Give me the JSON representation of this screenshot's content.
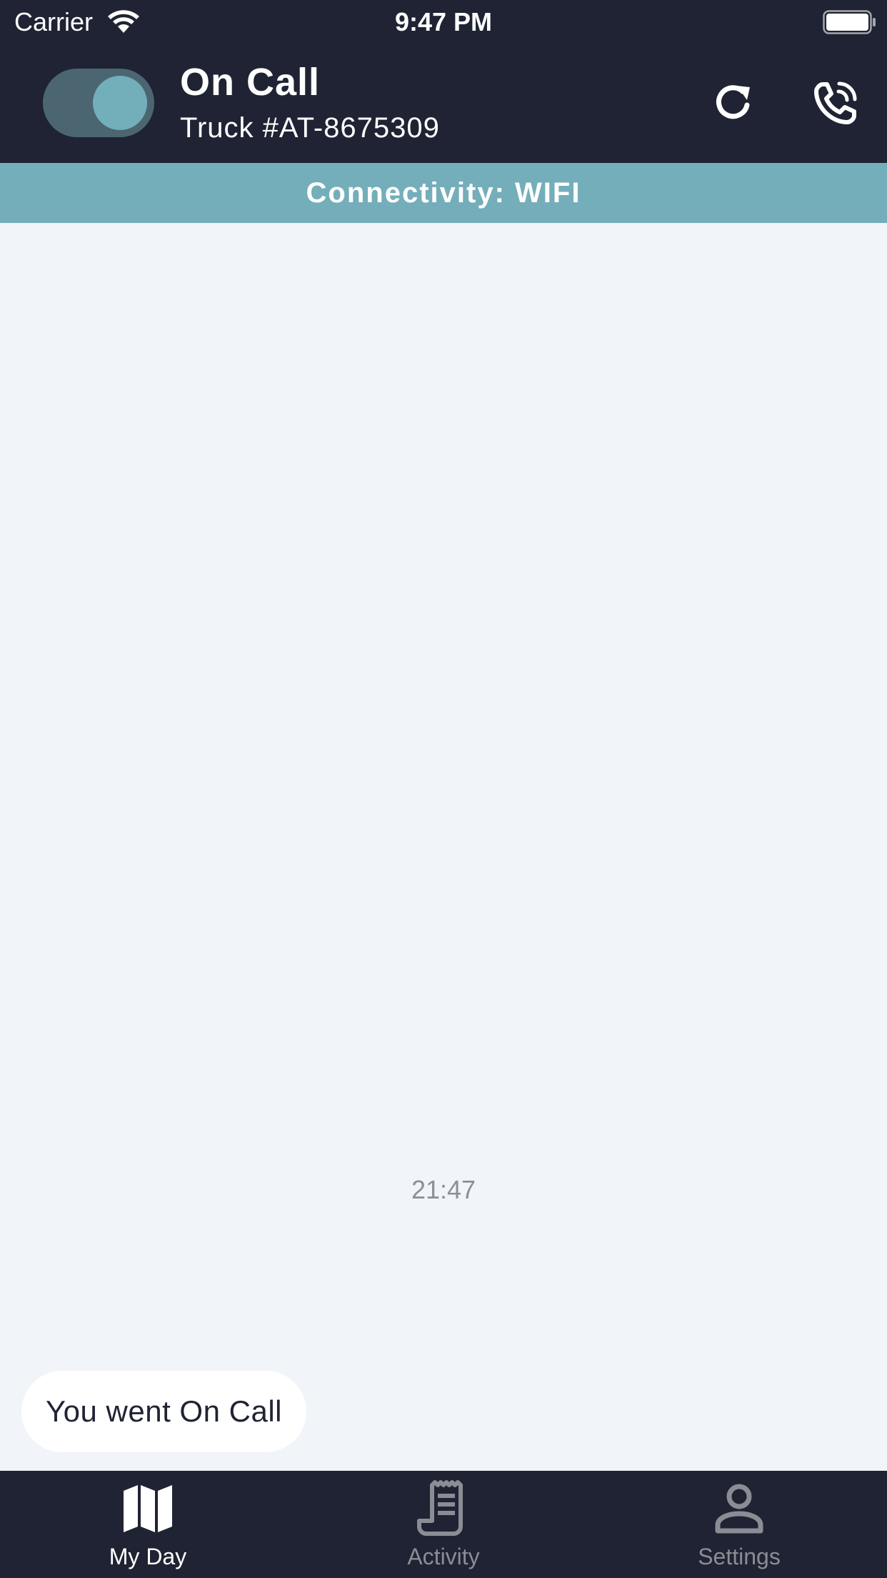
{
  "status_bar": {
    "carrier": "Carrier",
    "time": "9:47 PM"
  },
  "header": {
    "toggle_on": true,
    "title": "On Call",
    "subtitle": "Truck #AT-8675309",
    "actions": [
      "refresh-icon",
      "phone-icon"
    ]
  },
  "connectivity": {
    "label": "Connectivity: WIFI"
  },
  "feed": {
    "timestamp": "21:47",
    "messages": [
      {
        "text": "You went On Call"
      }
    ]
  },
  "tabbar": {
    "tabs": [
      {
        "label": "My Day",
        "icon": "map-icon",
        "active": true
      },
      {
        "label": "Activity",
        "icon": "receipt-icon",
        "active": false
      },
      {
        "label": "Settings",
        "icon": "person-icon",
        "active": false
      }
    ]
  },
  "colors": {
    "header_bg": "#1f2333",
    "banner_bg": "#74aeba",
    "toggle_track": "#4b6671",
    "toggle_knob": "#73aebb",
    "content_bg": "#f1f4f9",
    "inactive_tab": "#8a8d94"
  }
}
